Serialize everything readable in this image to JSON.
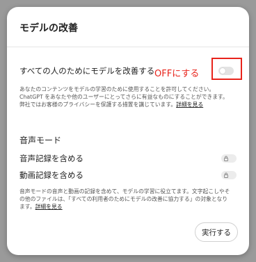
{
  "dialog": {
    "title": "モデルの改善",
    "improve_for_all_label": "すべての人のためにモデルを改善する",
    "improve_desc_text": "あなたのコンテンツをモデルの学習のために使用することを許可してください。ChatGPT をあなたや他のユーザーにとってさらに有益なものにすることができます。弊社ではお客様のプライバシーを保護する措置を講じています。",
    "improve_desc_link": "詳細を見る",
    "voice_section_title": "音声モード",
    "include_audio_label": "音声記録を含める",
    "include_video_label": "動画記録を含める",
    "voice_desc_text": "音声モードの音声と動画の記録を含めて、モデルの学習に役立てます。文字起こしやその他のファイルは、「すべての利用者のためにモデルの改善に協力する」の対象となります。",
    "voice_desc_link": "詳細を見る",
    "run_button": "実行する"
  },
  "annotation": {
    "text": "OFFにする",
    "color": "#e8231b"
  },
  "toggles": {
    "improve_for_all": "off",
    "include_audio": "off-locked",
    "include_video": "off-locked"
  }
}
